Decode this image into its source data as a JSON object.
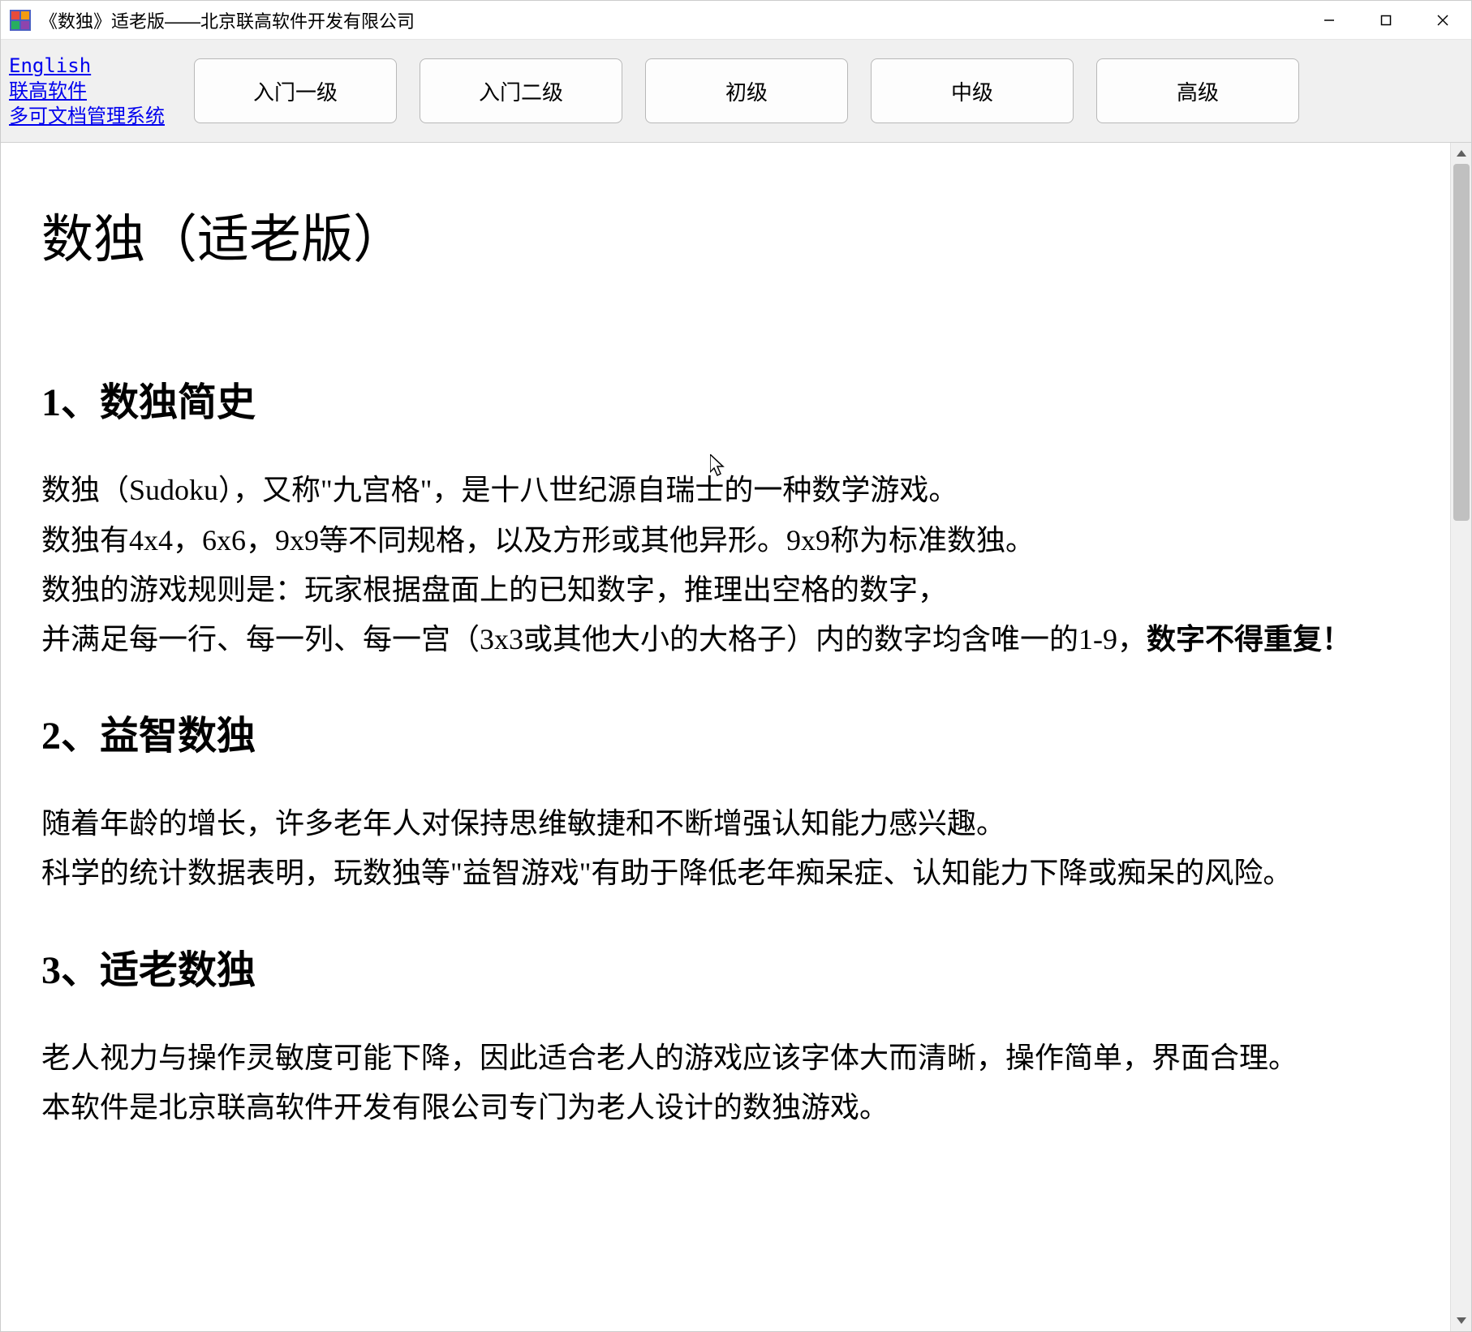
{
  "window": {
    "title": "《数独》适老版——北京联高软件开发有限公司"
  },
  "toolbar": {
    "links": [
      "English",
      "联高软件",
      "多可文档管理系统"
    ],
    "buttons": [
      "入门一级",
      "入门二级",
      "初级",
      "中级",
      "高级"
    ]
  },
  "content": {
    "main_title": "数独（适老版）",
    "section1": {
      "title": "1、数独简史",
      "p1": "数独（Sudoku），又称\"九宫格\"，是十八世纪源自瑞士的一种数学游戏。",
      "p2": "数独有4x4，6x6，9x9等不同规格，以及方形或其他异形。9x9称为标准数独。",
      "p3": "数独的游戏规则是：玩家根据盘面上的已知数字，推理出空格的数字，",
      "p4_prefix": "并满足每一行、每一列、每一宫（3x3或其他大小的大格子）内的数字均含唯一的1-9，",
      "p4_bold": "数字不得重复！"
    },
    "section2": {
      "title": "2、益智数独",
      "p1": "随着年龄的增长，许多老年人对保持思维敏捷和不断增强认知能力感兴趣。",
      "p2": "科学的统计数据表明，玩数独等\"益智游戏\"有助于降低老年痴呆症、认知能力下降或痴呆的风险。"
    },
    "section3": {
      "title": "3、适老数独",
      "p1": "老人视力与操作灵敏度可能下降，因此适合老人的游戏应该字体大而清晰，操作简单，界面合理。",
      "p2": "本软件是北京联高软件开发有限公司专门为老人设计的数独游戏。"
    }
  }
}
